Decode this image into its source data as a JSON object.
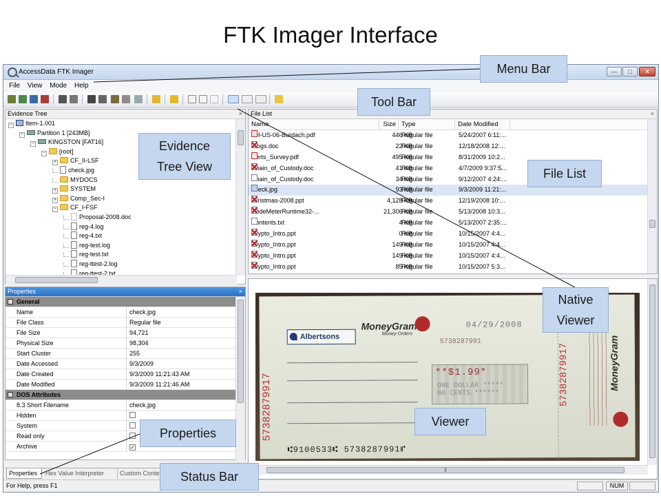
{
  "slide": {
    "title": "FTK Imager Interface"
  },
  "window": {
    "title": "AccessData FTK Imager",
    "min": "—",
    "max": "□",
    "close": "✕"
  },
  "menu": [
    "File",
    "View",
    "Mode",
    "Help"
  ],
  "evidence_tree": {
    "title": "Evidence Tree",
    "close": "×",
    "nodes": [
      {
        "depth": 0,
        "expander": "−",
        "icon": "computer",
        "label": "Item-1.001"
      },
      {
        "depth": 1,
        "expander": "−",
        "icon": "drive",
        "label": "Partition 1 [243MB]"
      },
      {
        "depth": 2,
        "expander": "−",
        "icon": "drive",
        "label": "KINGSTON [FAT16]"
      },
      {
        "depth": 3,
        "expander": "−",
        "icon": "folder",
        "label": "[root]"
      },
      {
        "depth": 4,
        "expander": "+",
        "icon": "folder",
        "label": "CF_II-LSF"
      },
      {
        "depth": 4,
        "expander": "",
        "icon": "file",
        "label": "check.jpg"
      },
      {
        "depth": 4,
        "expander": "",
        "icon": "folder",
        "label": "MYDOCS"
      },
      {
        "depth": 4,
        "expander": "+",
        "icon": "folder",
        "label": "SYSTEM"
      },
      {
        "depth": 4,
        "expander": "+",
        "icon": "folder",
        "label": "Comp_Sec-I"
      },
      {
        "depth": 4,
        "expander": "−",
        "icon": "folder",
        "label": "CF_I-FSF"
      },
      {
        "depth": 5,
        "expander": "",
        "icon": "file-gray",
        "label": "Proposal-2008.doc"
      },
      {
        "depth": 5,
        "expander": "",
        "icon": "file",
        "label": "reg-4.log"
      },
      {
        "depth": 5,
        "expander": "",
        "icon": "file",
        "label": "reg-4.txt"
      },
      {
        "depth": 5,
        "expander": "",
        "icon": "file",
        "label": "reg-test.log"
      },
      {
        "depth": 5,
        "expander": "",
        "icon": "file",
        "label": "reg-test.txt"
      },
      {
        "depth": 5,
        "expander": "",
        "icon": "file",
        "label": "reg-ttest-2.log"
      },
      {
        "depth": 5,
        "expander": "",
        "icon": "file",
        "label": "reg-ttest-2.txt"
      }
    ]
  },
  "properties": {
    "title": "Properties",
    "close": "×",
    "rows": [
      {
        "section": true,
        "expander": "⊟",
        "label": "General"
      },
      {
        "label": "Name",
        "value": "check.jpg"
      },
      {
        "label": "File Class",
        "value": "Regular file"
      },
      {
        "label": "File Size",
        "value": "94,721"
      },
      {
        "label": "Physical Size",
        "value": "98,304"
      },
      {
        "label": "Start Cluster",
        "value": "255"
      },
      {
        "label": "Date Accessed",
        "value": "9/3/2009"
      },
      {
        "label": "Date Created",
        "value": "9/3/2009 11:21:43 AM"
      },
      {
        "label": "Date Modified",
        "value": "9/3/2009 11:21:46 AM"
      },
      {
        "section": true,
        "expander": "⊟",
        "label": "DOS Attributes"
      },
      {
        "label": "8.3 Short Filename",
        "value": "check.jpg"
      },
      {
        "label": "Hidden",
        "checkbox": ""
      },
      {
        "label": "System",
        "checkbox": ""
      },
      {
        "label": "Read only",
        "checkbox": ""
      },
      {
        "label": "Archive",
        "checkbox": "✓"
      }
    ],
    "tabs": [
      "Properties",
      "Hex Value Interpreter",
      "Custom Conte"
    ]
  },
  "file_list": {
    "title": "File List",
    "close": "×",
    "columns": [
      "Name",
      "Size",
      "Type",
      "Date Modified"
    ],
    "rows": [
      {
        "icon": "pdf",
        "name": "BH-US-06-Burdach.pdf",
        "size": "446 KB",
        "type": "Regular file",
        "date": "5/24/2007 6:11:..."
      },
      {
        "icon": "deleted",
        "name": "Blogs.doc",
        "size": "22 KB",
        "type": "Regular file",
        "date": "12/18/2008 12:..."
      },
      {
        "icon": "pdf",
        "name": "Certs_Survey.pdf",
        "size": "495 KB",
        "type": "Regular file",
        "date": "8/31/2009 10:2..."
      },
      {
        "icon": "deleted",
        "name": "Chain_of_Custody.doc",
        "size": "41 KB",
        "type": "Regular file",
        "date": "4/7/2009 9:37:5..."
      },
      {
        "icon": "doc",
        "name": "Chain_of_Custody.doc",
        "size": "34 KB",
        "type": "Regular file",
        "date": "9/12/2007 4:24:..."
      },
      {
        "icon": "jpg",
        "name": "check.jpg",
        "size": "93 KB",
        "type": "Regular file",
        "date": "9/3/2009 11:21:...",
        "selected": true
      },
      {
        "icon": "deleted",
        "name": "christmas-2008.ppt",
        "size": "4,128 KB",
        "type": "Regular file",
        "date": "12/19/2008 10:..."
      },
      {
        "icon": "deleted",
        "name": "CodeMeterRuntime32-...",
        "size": "21,306 KB",
        "type": "Regular file",
        "date": "5/13/2008 10:3..."
      },
      {
        "icon": "doc",
        "name": "Contents.txt",
        "size": "4 KB",
        "type": "Regular file",
        "date": "5/13/2007 2:35:..."
      },
      {
        "icon": "deleted",
        "name": "Crypto_Intro.ppt",
        "size": "0 KB",
        "type": "Regular file",
        "date": "10/15/2007 4:4..."
      },
      {
        "icon": "deleted",
        "name": "Crypto_Intro.ppt",
        "size": "149 KB",
        "type": "Regular file",
        "date": "10/15/2007 4:4..."
      },
      {
        "icon": "deleted",
        "name": "Crypto_Intro.ppt",
        "size": "149 KB",
        "type": "Regular file",
        "date": "10/15/2007 4:4..."
      },
      {
        "icon": "deleted",
        "name": "Crypto_Intro.ppt",
        "size": "85 KB",
        "type": "Regular file",
        "date": "10/15/2007 5:3..."
      }
    ]
  },
  "viewer": {
    "check_date": "04/29/2008",
    "check_number": "5738287991",
    "check_serial": "57382879917",
    "amount_stars": "**$1.99*",
    "amount_words": "ONE DOLLAR *****\n00 CENTS ******",
    "micr": "⑆9100533⑆ 5738287991⑈",
    "payee_brand": "Albertsons",
    "issuer_brand": "MoneyGram",
    "issuer_sub": "Money Orders"
  },
  "scroll": {
    "grip": "⦀"
  },
  "status": {
    "text": "For Help, press F1",
    "num": "NUM"
  },
  "callouts": {
    "menu_bar": "Menu Bar",
    "tool_bar": "Tool Bar",
    "evidence_tree": "Evidence\nTree View",
    "file_list": "File List",
    "native_viewer": "Native\nViewer",
    "viewer": "Viewer",
    "properties": "Properties",
    "status_bar": "Status Bar"
  },
  "colors": {
    "callout_fill": "#c5d7ee",
    "callout_border": "#93aed2",
    "section_gray": "#8c8c8c",
    "selected_row": "#dbe6f4",
    "active_panel": "#2b72c6"
  }
}
